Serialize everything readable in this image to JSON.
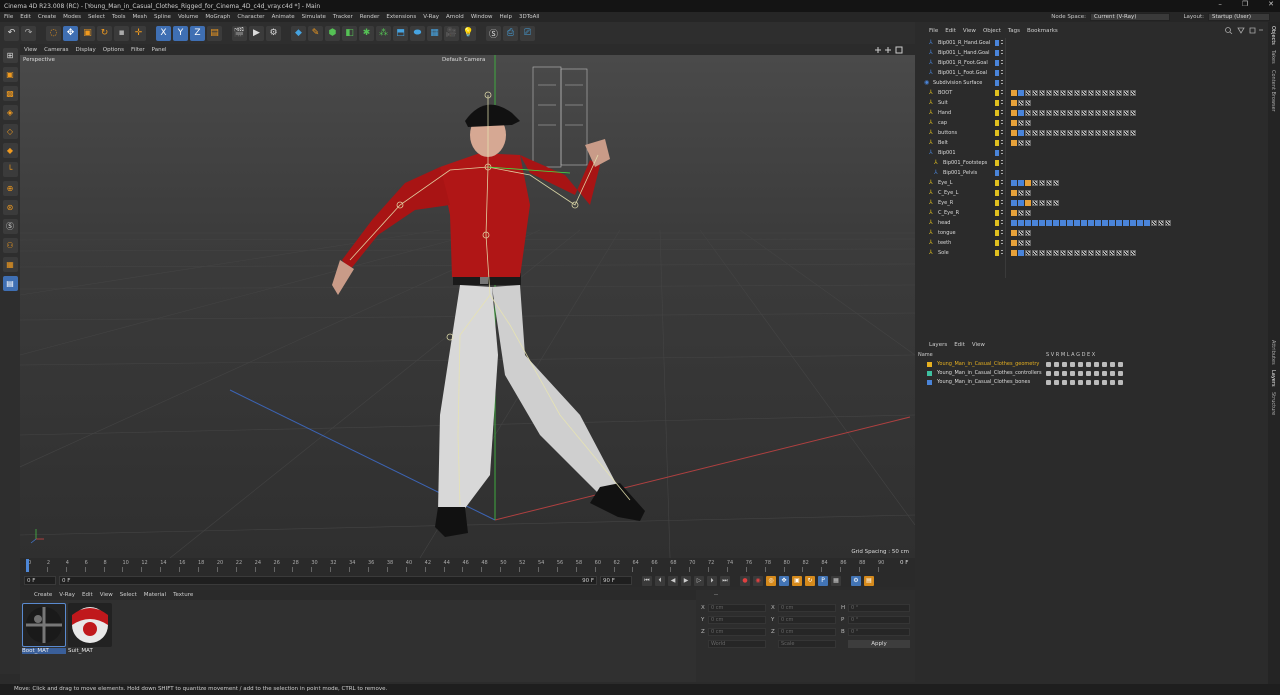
{
  "window": {
    "title": "Cinema 4D R23.008 (RC) - [Young_Man_in_Casual_Clothes_Rigged_for_Cinema_4D_c4d_vray.c4d *] - Main",
    "controls": [
      "–",
      "❐",
      "✕"
    ]
  },
  "menubar": {
    "items": [
      "File",
      "Edit",
      "Create",
      "Modes",
      "Select",
      "Tools",
      "Mesh",
      "Spline",
      "Volume",
      "MoGraph",
      "Character",
      "Animate",
      "Simulate",
      "Tracker",
      "Render",
      "Extensions",
      "V-Ray",
      "Arnold",
      "Window",
      "Help",
      "3DToAll"
    ],
    "node_space_label": "Node Space:",
    "node_space_value": "Current (V-Ray)",
    "layout_label": "Layout:",
    "layout_value": "Startup (User)"
  },
  "toolbar": {
    "icons": [
      "undo-icon",
      "redo-icon",
      "live-selection-icon",
      "move-icon",
      "scale-icon",
      "rotate-icon",
      "recent-tool-icon",
      "create-icon",
      "x-axis-icon",
      "y-axis-icon",
      "z-axis-icon",
      "coordinate-system-icon",
      "render-view-icon",
      "render-picture-viewer-icon",
      "edit-render-settings-icon",
      "cube-icon",
      "pen-icon",
      "subdivision-icon",
      "cloner-icon",
      "selector-icon",
      "field-icon",
      "deformer-icon",
      "spline-icon",
      "environment-icon",
      "camera-icon",
      "light-icon",
      "vray-icon",
      "vray-render-icon",
      "vray-vfb-icon"
    ],
    "axis_labels": [
      "X",
      "Y",
      "Z"
    ]
  },
  "left_tools": [
    "make-editable-icon",
    "model-mode-icon",
    "texture-mode-icon",
    "points-mode-icon",
    "edges-mode-icon",
    "polygons-mode-icon",
    "axis-mode-icon",
    "snap-icon",
    "snap-settings-icon",
    "vray-s-icon",
    "workplane-icon",
    "solo-icon",
    "layer-icon"
  ],
  "viewport": {
    "menu": [
      "View",
      "Cameras",
      "Display",
      "Options",
      "Filter",
      "Panel"
    ],
    "label": "Perspective",
    "camera": "Default Camera",
    "grid_spacing": "Grid Spacing : 50 cm"
  },
  "timeline": {
    "ticks": [
      "0",
      "2",
      "4",
      "6",
      "8",
      "10",
      "12",
      "14",
      "16",
      "18",
      "20",
      "22",
      "24",
      "26",
      "28",
      "30",
      "32",
      "34",
      "36",
      "38",
      "40",
      "42",
      "44",
      "46",
      "48",
      "50",
      "52",
      "54",
      "56",
      "58",
      "60",
      "62",
      "64",
      "66",
      "68",
      "70",
      "72",
      "74",
      "76",
      "78",
      "80",
      "82",
      "84",
      "86",
      "88",
      "90"
    ],
    "current_frame": "0 F"
  },
  "playbar": {
    "start": "0 F",
    "min": "0 F",
    "max": "90 F",
    "end": "90 F"
  },
  "materials": {
    "menu": [
      "Create",
      "V-Ray",
      "Edit",
      "View",
      "Select",
      "Material",
      "Texture"
    ],
    "items": [
      {
        "label": "Boot_MAT"
      },
      {
        "label": "Suit_MAT"
      }
    ]
  },
  "attributes": {
    "header": "--",
    "rows": [
      {
        "a": "X",
        "av": "0 cm",
        "b": "X",
        "bv": "0 cm",
        "c": "H",
        "cv": "0 °"
      },
      {
        "a": "Y",
        "av": "0 cm",
        "b": "Y",
        "bv": "0 cm",
        "c": "P",
        "cv": "0 °"
      },
      {
        "a": "Z",
        "av": "0 cm",
        "b": "Z",
        "bv": "0 cm",
        "c": "B",
        "cv": "0 °"
      }
    ],
    "coord_system": "World",
    "scale_mode": "Scale",
    "apply": "Apply"
  },
  "object_manager": {
    "menu": [
      "File",
      "Edit",
      "View",
      "Object",
      "Tags",
      "Bookmarks"
    ],
    "objects": [
      {
        "name": "Bip001_R_Hand.Goal",
        "indent": 1,
        "color": "#4a84d9"
      },
      {
        "name": "Bip001_L_Hand.Goal",
        "indent": 1,
        "color": "#4a84d9"
      },
      {
        "name": "Bip001_R_Foot.Goal",
        "indent": 1,
        "color": "#4a84d9"
      },
      {
        "name": "Bip001_L_Foot.Goal",
        "indent": 1,
        "color": "#4a84d9"
      },
      {
        "name": "Subdivision Surface",
        "indent": 0,
        "color": "#4a84d9"
      },
      {
        "name": "BOOT",
        "indent": 1,
        "color": "#e0c020"
      },
      {
        "name": "Suit",
        "indent": 1,
        "color": "#e0c020"
      },
      {
        "name": "Hand",
        "indent": 1,
        "color": "#e0c020"
      },
      {
        "name": "cap",
        "indent": 1,
        "color": "#e0c020"
      },
      {
        "name": "buttons",
        "indent": 1,
        "color": "#e0c020"
      },
      {
        "name": "Belt",
        "indent": 1,
        "color": "#e0c020"
      },
      {
        "name": "Bip001",
        "indent": 1,
        "color": "#4a84d9"
      },
      {
        "name": "Bip001_Footsteps",
        "indent": 2,
        "color": "#e0c020"
      },
      {
        "name": "Bip001_Pelvis",
        "indent": 2,
        "color": "#4a84d9"
      },
      {
        "name": "Eye_L",
        "indent": 1,
        "color": "#e0c020"
      },
      {
        "name": "C_Eye_L",
        "indent": 1,
        "color": "#e0c020"
      },
      {
        "name": "Eye_R",
        "indent": 1,
        "color": "#e0c020"
      },
      {
        "name": "C_Eye_R",
        "indent": 1,
        "color": "#e0c020"
      },
      {
        "name": "head",
        "indent": 1,
        "color": "#e0c020"
      },
      {
        "name": "tongue",
        "indent": 1,
        "color": "#e0c020"
      },
      {
        "name": "teeth",
        "indent": 1,
        "color": "#e0c020"
      },
      {
        "name": "Sole",
        "indent": 1,
        "color": "#e0c020"
      }
    ]
  },
  "layers": {
    "menu": [
      "Layers",
      "Edit",
      "View"
    ],
    "header_name": "Name",
    "header_cols": "S V R M L A G D E X",
    "items": [
      {
        "name": "Young_Man_in_Casual_Clothes_geometry",
        "color": "#e6b020"
      },
      {
        "name": "Young_Man_in_Casual_Clothes_controllers",
        "color": "#3ec0a0"
      },
      {
        "name": "Young_Man_in_Casual_Clothes_bones",
        "color": "#4a84d9"
      }
    ]
  },
  "right_tabs": [
    "Objects",
    "Takes",
    "Content Browser",
    "Attributes",
    "Layers",
    "Structure"
  ],
  "statusbar": "Move: Click and drag to move elements. Hold down SHIFT to quantize movement / add to the selection in point mode, CTRL to remove."
}
